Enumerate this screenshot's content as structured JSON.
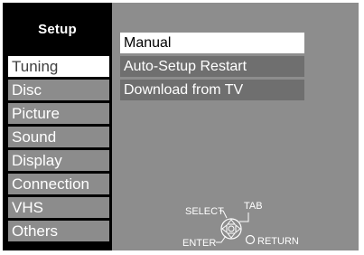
{
  "menu": {
    "title": "Setup",
    "categories": [
      {
        "label": "Tuning",
        "selected": true
      },
      {
        "label": "Disc",
        "selected": false
      },
      {
        "label": "Picture",
        "selected": false
      },
      {
        "label": "Sound",
        "selected": false
      },
      {
        "label": "Display",
        "selected": false
      },
      {
        "label": "Connection",
        "selected": false
      },
      {
        "label": "VHS",
        "selected": false
      },
      {
        "label": "Others",
        "selected": false
      }
    ]
  },
  "submenu": {
    "items": [
      {
        "label": "Manual",
        "selected": true
      },
      {
        "label": "Auto-Setup Restart",
        "selected": false
      },
      {
        "label": "Download from TV",
        "selected": false
      }
    ]
  },
  "legend": {
    "select": "SELECT",
    "tab": "TAB",
    "enter": "ENTER",
    "return": "RETURN"
  },
  "colors": {
    "frame": "#8d8d8d",
    "left_panel": "#000000",
    "item_bg": "#8c8c8c",
    "submenu_bg": "#6f6f6f",
    "highlight": "#ffffff"
  }
}
